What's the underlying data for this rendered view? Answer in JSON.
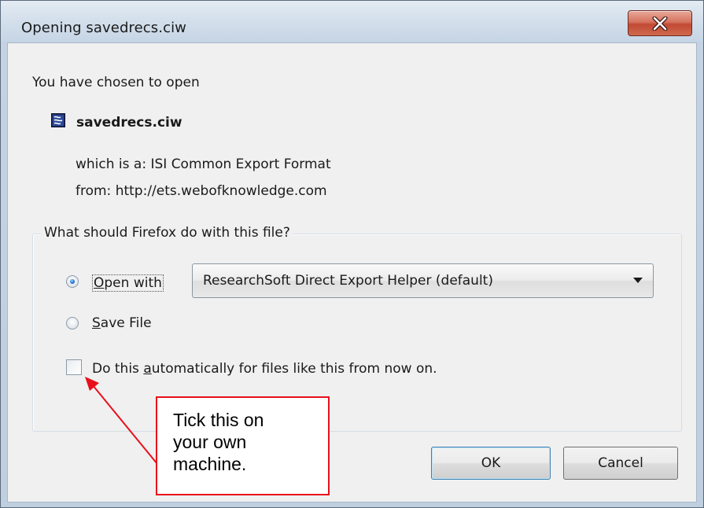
{
  "window": {
    "title": "Opening savedrecs.ciw"
  },
  "dialog": {
    "intro": "You have chosen to open",
    "file_name": "savedrecs.ciw",
    "which_is_label": "which is a:",
    "which_is_value": "ISI Common Export Format",
    "from_label": "from:",
    "from_value": "http://ets.webofknowledge.com",
    "group_title": "What should Firefox do with this file?",
    "open_with": {
      "label_prefix": "",
      "label_accel": "O",
      "label_rest": "pen with",
      "selected": true,
      "application": "ResearchSoft Direct Export Helper (default)"
    },
    "save_file": {
      "label_accel": "S",
      "label_rest": "ave File",
      "selected": false
    },
    "auto_checkbox": {
      "label_before": "Do this ",
      "label_accel": "a",
      "label_after": "utomatically for files like this from now on.",
      "checked": false
    },
    "ok_label": "OK",
    "cancel_label": "Cancel"
  },
  "annotation": {
    "lines": [
      "Tick this on",
      "your own",
      "machine."
    ],
    "color": "#e8101a"
  },
  "icons": {
    "close": "close-icon",
    "file": "file-icon",
    "dropdown": "chevron-down-icon"
  }
}
